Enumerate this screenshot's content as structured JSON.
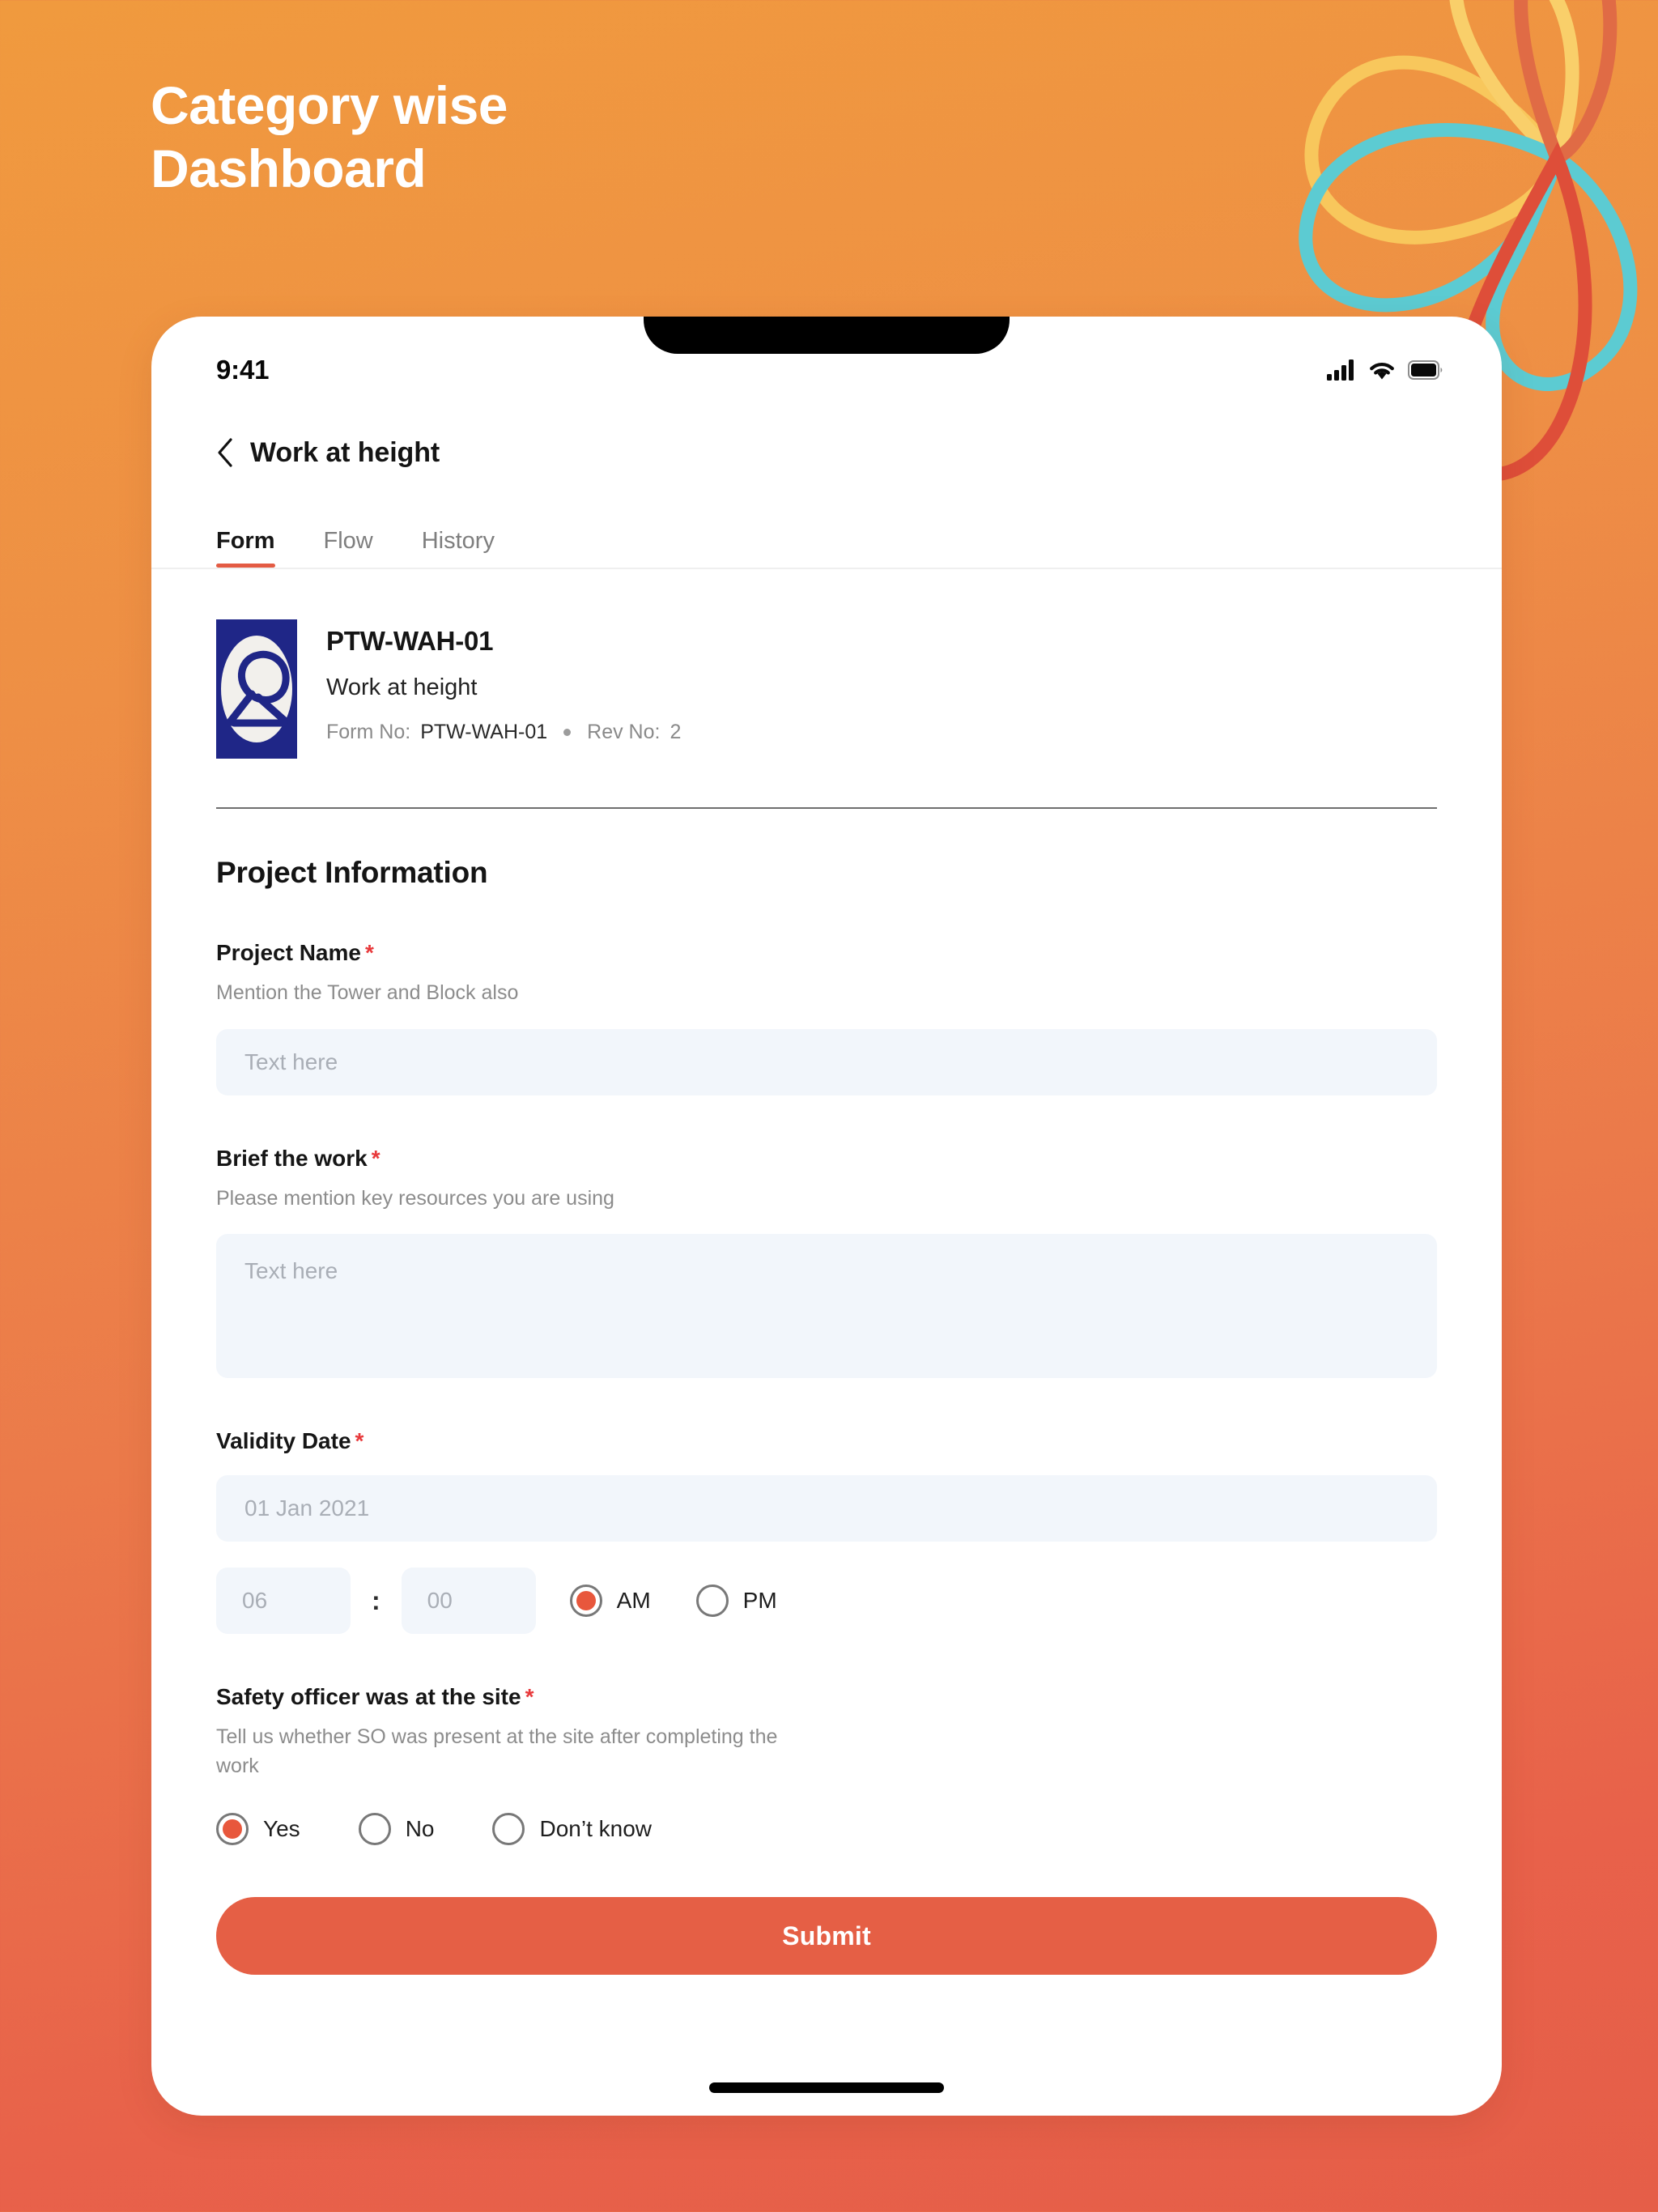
{
  "poster": {
    "title_line1": "Category wise",
    "title_line2": "Dashboard",
    "background_top_color": "#F09A3E",
    "background_bottom_color": "#E8614A"
  },
  "decor": {
    "loop_yellow_color": "#F7C354",
    "loop_teal_color": "#5BC8CE",
    "loop_orange_color": "#E36A44",
    "loop_red_color": "#DE4B3A"
  },
  "status_bar": {
    "time": "9:41",
    "signal_icon": "cellular-signal-icon",
    "wifi_icon": "wifi-icon",
    "battery_icon": "battery-icon"
  },
  "nav": {
    "back_icon": "chevron-left-icon",
    "title": "Work at height"
  },
  "tabs": [
    {
      "label": "Form",
      "active": true
    },
    {
      "label": "Flow",
      "active": false
    },
    {
      "label": "History",
      "active": false
    }
  ],
  "form_header": {
    "logo_icon": "company-ribbon-logo-icon",
    "code": "PTW-WAH-01",
    "name": "Work at height",
    "meta_form_no_label": "Form No:",
    "meta_form_no_value": "PTW-WAH-01",
    "meta_rev_label": "Rev No:",
    "meta_rev_value": "2"
  },
  "section": {
    "title": "Project Information"
  },
  "fields": {
    "project_name": {
      "label": "Project Name",
      "required_mark": "*",
      "help": "Mention the Tower and Block also",
      "placeholder": "Text here",
      "value": ""
    },
    "brief_work": {
      "label": "Brief the work",
      "required_mark": "*",
      "help": "Please mention key resources you are using",
      "placeholder": "Text here",
      "value": ""
    },
    "validity_date": {
      "label": "Validity Date",
      "required_mark": "*",
      "date_placeholder": "01 Jan 2021",
      "hour_placeholder": "06",
      "minute_placeholder": "00",
      "separator": ":",
      "meridiem_options": [
        {
          "label": "AM",
          "selected": true
        },
        {
          "label": "PM",
          "selected": false
        }
      ]
    },
    "safety_officer": {
      "label": "Safety officer was at the site",
      "required_mark": "*",
      "help": "Tell us whether SO was present at the site after completing the work",
      "options": [
        {
          "label": "Yes",
          "selected": true
        },
        {
          "label": "No",
          "selected": false
        },
        {
          "label": "Don’t know",
          "selected": false
        }
      ]
    }
  },
  "submit": {
    "label": "Submit",
    "color": "#E55F45"
  },
  "theme": {
    "accent": "#E35B43",
    "required_red": "#E8393B",
    "input_bg": "#F2F6FB",
    "logo_navy": "#1F2687"
  }
}
